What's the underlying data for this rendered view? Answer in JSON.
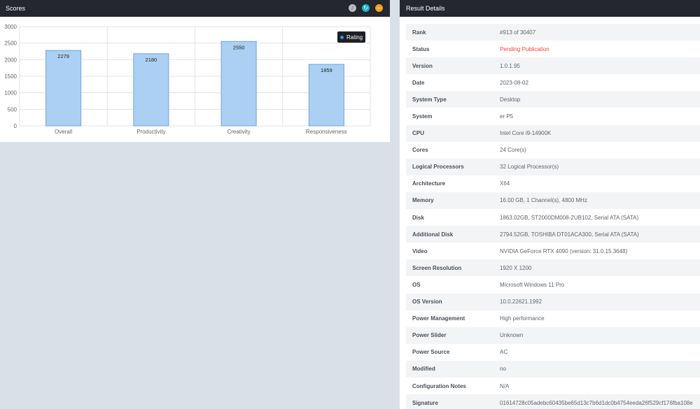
{
  "scores_panel": {
    "title": "Scores",
    "icons": [
      "pin-icon",
      "refresh-icon",
      "minimize-icon"
    ],
    "legend_label": "Rating"
  },
  "chart_data": {
    "type": "bar",
    "categories": [
      "Overall",
      "Productivity",
      "Creativity",
      "Responsiveness"
    ],
    "series": [
      {
        "name": "Rating",
        "values": [
          2279,
          2180,
          2550,
          1859
        ]
      }
    ],
    "ylim": [
      0,
      3000
    ],
    "yticks": [
      0,
      500,
      1000,
      1500,
      2000,
      2500,
      3000
    ],
    "grid": true,
    "legend_position": "top-right",
    "bar_color": "#acd0f3",
    "bar_border": "#6ca4de"
  },
  "details_panel": {
    "title": "Result Details",
    "pending_color": "#e9463b",
    "rows": [
      {
        "label": "Rank",
        "value": "#913 of 30407"
      },
      {
        "label": "Status",
        "value": "Pending Publication",
        "highlight": true
      },
      {
        "label": "Version",
        "value": "1.0.1.95"
      },
      {
        "label": "Date",
        "value": "2023-08-02"
      },
      {
        "label": "System Type",
        "value": "Desktop"
      },
      {
        "label": "System",
        "value": "er P5"
      },
      {
        "label": "CPU",
        "value": "Intel Core i9-14900K"
      },
      {
        "label": "Cores",
        "value": "24 Core(s)"
      },
      {
        "label": "Logical Processors",
        "value": "32 Logical Processor(s)"
      },
      {
        "label": "Architecture",
        "value": "X64"
      },
      {
        "label": "Memory",
        "value": "16.00 GB, 1 Channel(s), 4800 MHz"
      },
      {
        "label": "Disk",
        "value": "1863.02GB, ST2000DM008-2UB102, Serial ATA (SATA)"
      },
      {
        "label": "Additional Disk",
        "value": "2794.52GB, TOSHIBA DT01ACA300, Serial ATA (SATA)"
      },
      {
        "label": "Video",
        "value": "NVIDIA GeForce RTX 4090 (version: 31.0.15.3648)"
      },
      {
        "label": "Screen Resolution",
        "value": "1920 X 1200"
      },
      {
        "label": "OS",
        "value": "Microsoft Windows 11 Pro"
      },
      {
        "label": "OS Version",
        "value": "10.0.22621.1992"
      },
      {
        "label": "Power Management",
        "value": "High performance"
      },
      {
        "label": "Power Slider",
        "value": "Unknown"
      },
      {
        "label": "Power Source",
        "value": "AC"
      },
      {
        "label": "Modified",
        "value": "no"
      },
      {
        "label": "Configuration Notes",
        "value": "N/A"
      },
      {
        "label": "Signature",
        "value": "01614728c05adebc60435be65d13c7b6d1dc0b4754eeda26f529cf176fba108e"
      }
    ]
  }
}
